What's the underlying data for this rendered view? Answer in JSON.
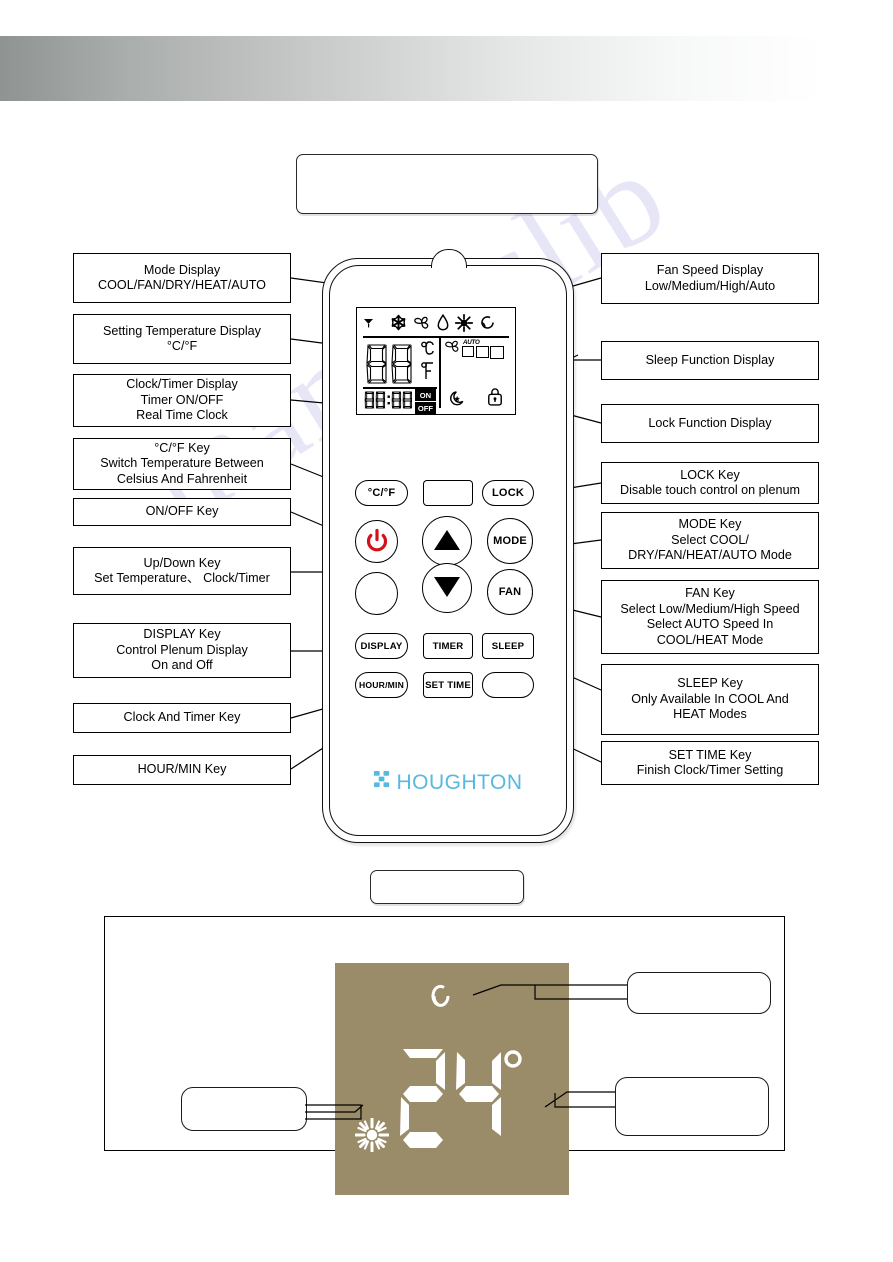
{
  "document": {
    "watermark_text": "manualslib",
    "brand": "HOUGHTON",
    "brand_color": "#57b8e0"
  },
  "top_title_box": {
    "text": ""
  },
  "mid_title_box": {
    "text": ""
  },
  "left_labels": [
    {
      "name": "mode-display",
      "lines": [
        "Mode Display",
        "COOL/FAN/DRY/HEAT/AUTO"
      ]
    },
    {
      "name": "setting-temperature-display",
      "lines": [
        "Setting Temperature Display",
        "°C/°F"
      ]
    },
    {
      "name": "clock-timer-display",
      "lines": [
        "Clock/Timer Display",
        "Timer ON/OFF",
        "Real Time Clock"
      ]
    },
    {
      "name": "celsius-fahrenheit-key",
      "lines": [
        "°C/°F  Key",
        "Switch Temperature Between",
        "Celsius And Fahrenheit"
      ]
    },
    {
      "name": "on-off-key",
      "lines": [
        "ON/OFF  Key"
      ]
    },
    {
      "name": "up-down-key",
      "lines": [
        "Up/Down Key",
        "Set Temperature、 Clock/Timer"
      ]
    },
    {
      "name": "display-key",
      "lines": [
        "DISPLAY Key",
        "Control Plenum Display",
        "On and Off"
      ]
    },
    {
      "name": "clock-and-timer-key",
      "lines": [
        "Clock And Timer Key"
      ]
    },
    {
      "name": "hour-min-key",
      "lines": [
        "HOUR/MIN Key"
      ]
    }
  ],
  "right_labels": [
    {
      "name": "fan-speed-display",
      "lines": [
        "Fan Speed Display",
        "Low/Medium/High/Auto"
      ]
    },
    {
      "name": "sleep-function-display",
      "lines": [
        "Sleep Function Display"
      ]
    },
    {
      "name": "lock-function-display",
      "lines": [
        "Lock Function Display"
      ]
    },
    {
      "name": "lock-key",
      "lines": [
        "LOCK Key",
        "Disable touch control on plenum"
      ]
    },
    {
      "name": "mode-key",
      "lines": [
        "MODE Key",
        "Select COOL/",
        "DRY/FAN/HEAT/AUTO Mode"
      ]
    },
    {
      "name": "fan-key",
      "lines": [
        "FAN Key",
        "Select Low/Medium/High Speed",
        "Select AUTO Speed In",
        "COOL/HEAT Mode"
      ]
    },
    {
      "name": "sleep-key",
      "lines": [
        "SLEEP Key",
        "Only Available In COOL And",
        "HEAT Modes"
      ]
    },
    {
      "name": "set-time-key",
      "lines": [
        "SET TIME Key",
        "Finish  Clock/Timer Setting"
      ]
    }
  ],
  "remote": {
    "lcd": {
      "status_icons": [
        "signal-icon",
        "snowflake-icon",
        "fan-icon",
        "droplet-icon",
        "sun-icon",
        "auto-cycle-icon"
      ],
      "temperature_value": "88",
      "unit_c": "°C",
      "unit_f": "°F",
      "clock_value": "88:88",
      "timer_on_label": "ON",
      "timer_off_label": "OFF",
      "fan_auto_label": "AUTO",
      "fan_bars": 3,
      "sleep_icon": "moon-icon",
      "lock_icon": "padlock-icon"
    },
    "buttons": [
      {
        "name": "celsius-fahrenheit-button",
        "label": "°C/°F",
        "shape": "pill"
      },
      {
        "name": "blank-button-top",
        "label": "",
        "shape": "rect"
      },
      {
        "name": "lock-button",
        "label": "LOCK",
        "shape": "pill"
      },
      {
        "name": "power-button",
        "label": "",
        "shape": "circle",
        "icon": "power-icon",
        "color": "#d6101a"
      },
      {
        "name": "up-button",
        "label": "",
        "shape": "circle",
        "icon": "triangle-up-icon"
      },
      {
        "name": "mode-button",
        "label": "MODE",
        "shape": "circle"
      },
      {
        "name": "blank-button-mid",
        "label": "",
        "shape": "circle"
      },
      {
        "name": "down-button",
        "label": "",
        "shape": "circle",
        "icon": "triangle-down-icon"
      },
      {
        "name": "fan-button",
        "label": "FAN",
        "shape": "circle"
      },
      {
        "name": "display-button",
        "label": "DISPLAY",
        "shape": "pill"
      },
      {
        "name": "timer-button",
        "label": "TIMER",
        "shape": "rect"
      },
      {
        "name": "sleep-button",
        "label": "SLEEP",
        "shape": "rect"
      },
      {
        "name": "hour-min-button",
        "label": "HOUR/MIN",
        "shape": "pill"
      },
      {
        "name": "set-time-button",
        "label": "SET TIME",
        "shape": "rect"
      },
      {
        "name": "blank-button-bottom",
        "label": "",
        "shape": "pill"
      }
    ]
  },
  "plenum_figure": {
    "display": {
      "temperature_value": "24",
      "degree_symbol": "°",
      "icons": [
        "auto-cycle-icon",
        "sun-icon"
      ],
      "background_color": "#9a8c68",
      "segment_color": "#ffffff"
    },
    "callouts": [
      {
        "name": "callout-top-right",
        "text": ""
      },
      {
        "name": "callout-bottom-right",
        "text": ""
      },
      {
        "name": "callout-bottom-left",
        "text": ""
      }
    ]
  }
}
